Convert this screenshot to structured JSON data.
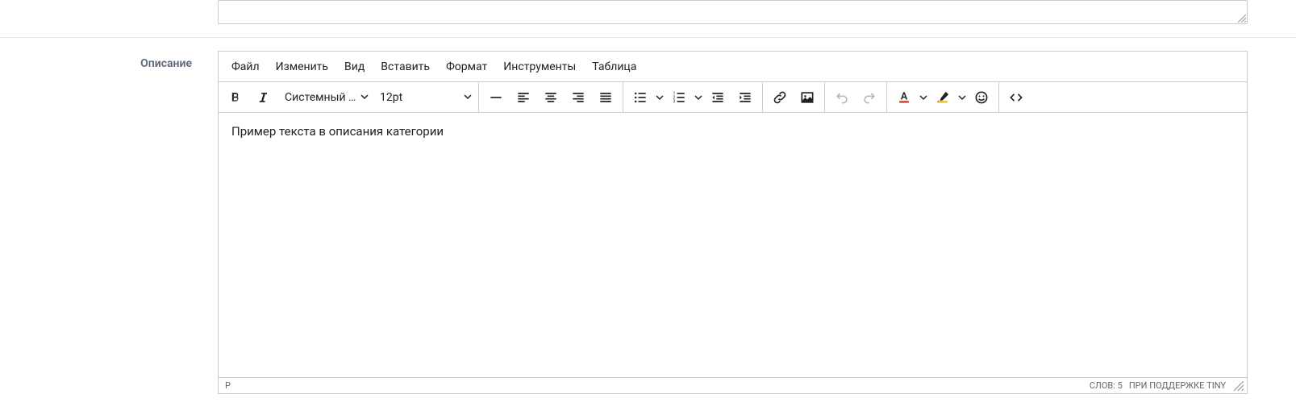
{
  "prev_field": {
    "label": ""
  },
  "description_label": "Описание",
  "menubar": {
    "file": "Файл",
    "edit": "Изменить",
    "view": "Вид",
    "insert": "Вставить",
    "format": "Формат",
    "tools": "Инструменты",
    "table": "Таблица"
  },
  "toolbar": {
    "font_family": "Системный …",
    "font_size": "12pt"
  },
  "content": "Пример текста в описания категории",
  "statusbar": {
    "path": "P",
    "word_count": "СЛОВ: 5",
    "powered_by": "ПРИ ПОДДЕРЖКЕ TINY"
  }
}
